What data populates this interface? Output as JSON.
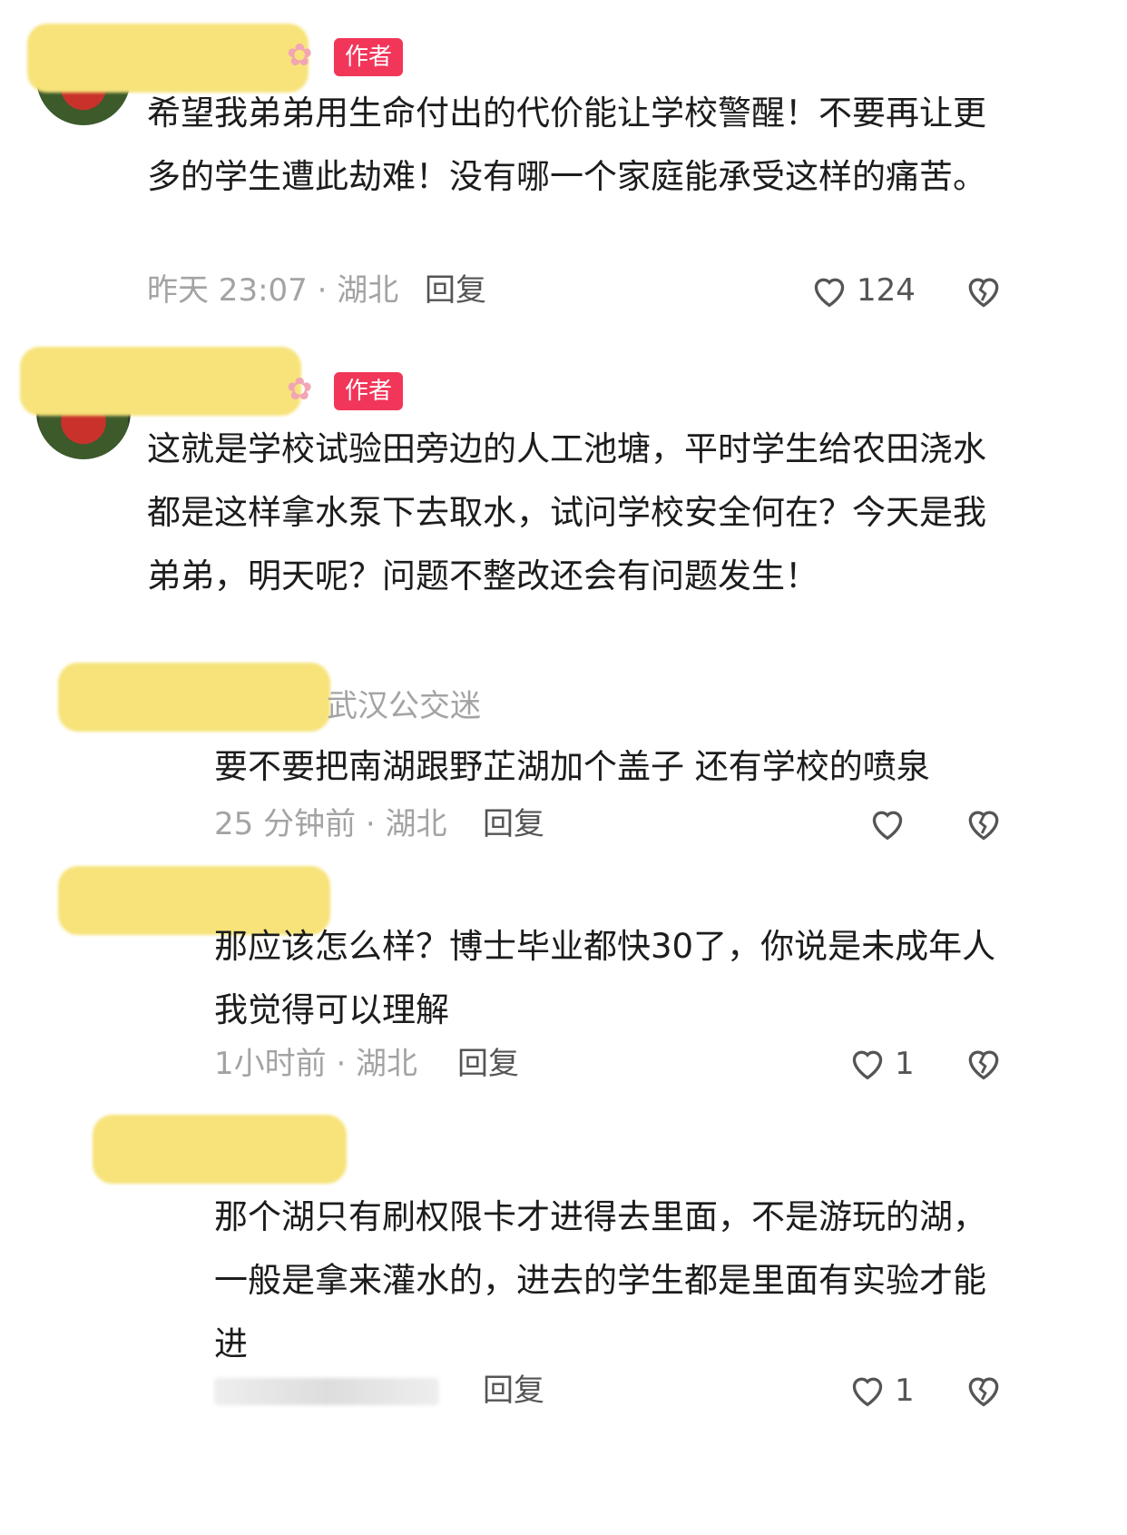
{
  "badge_author": "作者",
  "comments": [
    {
      "content": "希望我弟弟用生命付出的代价能让学校警醒！不要再让更多的学生遭此劫难！没有哪一个家庭能承受这样的痛苦。",
      "meta": "昨天 23:07 · 湖北",
      "reply": "回复",
      "likes": "124"
    },
    {
      "content": "这就是学校试验田旁边的人工池塘，平时学生给农田浇水都是这样拿水泵下去取水，试问学校安全何在？今天是我弟弟，明天呢？问题不整改还会有问题发生！"
    }
  ],
  "replies": [
    {
      "username": "武汉公交迷",
      "content": "要不要把南湖跟野芷湖加个盖子 还有学校的喷泉",
      "meta": "25 分钟前 · 湖北",
      "reply": "回复",
      "likes": ""
    },
    {
      "content": "那应该怎么样？博士毕业都快30了，你说是未成年人我觉得可以理解",
      "meta": "1小时前 · 湖北",
      "reply": "回复",
      "likes": "1"
    },
    {
      "content": "那个湖只有刷权限卡才进得去里面，不是游玩的湖，一般是拿来灌水的，进去的学生都是里面有实验才能进",
      "reply": "回复",
      "likes": "1"
    }
  ],
  "icons": {
    "like": "heart-outline-icon",
    "dislike": "broken-heart-icon",
    "flower": "flower-icon"
  },
  "colors": {
    "badge": "#f2365a",
    "redaction": "#f7e37a",
    "meta_text": "#a3a3a3"
  }
}
